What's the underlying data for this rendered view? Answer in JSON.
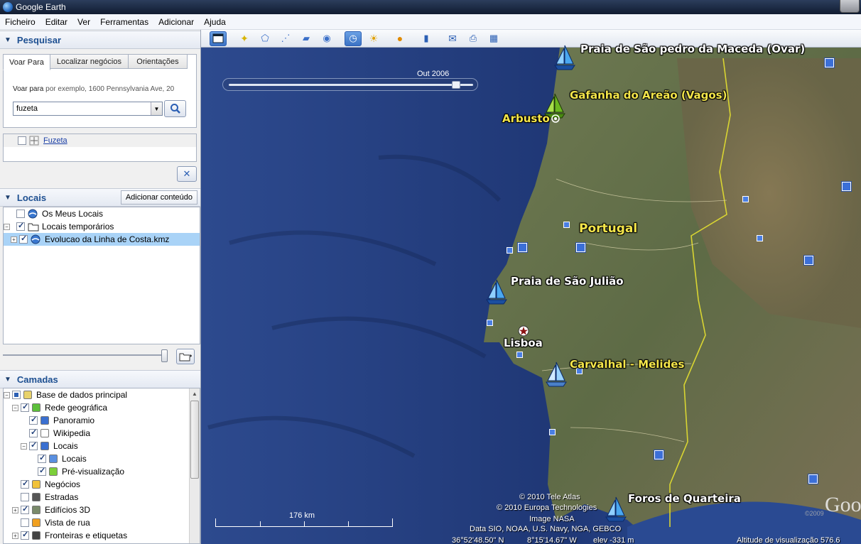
{
  "window": {
    "title": "Google Earth"
  },
  "menu": [
    "Ficheiro",
    "Editar",
    "Ver",
    "Ferramentas",
    "Adicionar",
    "Ajuda"
  ],
  "search": {
    "header": "Pesquisar",
    "tabs": [
      "Voar Para",
      "Localizar negócios",
      "Orientações"
    ],
    "fly_label": "Voar para",
    "fly_hint": "por exemplo, 1600 Pennsylvania Ave, 20",
    "input_value": "fuzeta",
    "result": "Fuzeta"
  },
  "places": {
    "header": "Locais",
    "add_content": "Adicionar conteúdo",
    "items": [
      {
        "label": "Os Meus Locais",
        "checked": false
      },
      {
        "label": "Locais temporários",
        "checked": true
      },
      {
        "label": "Evolucao da Linha de Costa.kmz",
        "checked": true
      }
    ]
  },
  "layers": {
    "header": "Camadas",
    "items": [
      {
        "label": "Base de dados principal",
        "indent": 0,
        "state": "partial"
      },
      {
        "label": "Rede geográfica",
        "indent": 1,
        "state": "checked"
      },
      {
        "label": "Panoramio",
        "indent": 2,
        "state": "checked"
      },
      {
        "label": "Wikipedia",
        "indent": 2,
        "state": "checked"
      },
      {
        "label": "Locais",
        "indent": 2,
        "state": "checked"
      },
      {
        "label": "Locais",
        "indent": 3,
        "state": "checked"
      },
      {
        "label": "Pré-visualização",
        "indent": 3,
        "state": "checked"
      },
      {
        "label": "Negócios",
        "indent": 1,
        "state": "checked"
      },
      {
        "label": "Estradas",
        "indent": 1,
        "state": "unchecked"
      },
      {
        "label": "Edifícios 3D",
        "indent": 1,
        "state": "checked"
      },
      {
        "label": "Vista de rua",
        "indent": 1,
        "state": "unchecked"
      },
      {
        "label": "Fronteiras e etiquetas",
        "indent": 1,
        "state": "checked"
      }
    ]
  },
  "map": {
    "time_label": "Out 2006",
    "labels": {
      "top": "Praia de São pedro da Maceda (Ovar)",
      "gafanha": "Gafanha do Areão (Vagos)",
      "arbusto": "Arbusto",
      "portugal": "Portugal",
      "juliao": "Praia de São Julião",
      "lisboa": "Lisboa",
      "carvalhal": "Carvalhal - Melides",
      "foros": "Foros de Quarteira"
    },
    "scale": "176 km",
    "attribution": [
      "© 2010 Tele Atlas",
      "© 2010 Europa Technologies",
      "Image NASA",
      "Data SIO, NOAA, U.S. Navy, NGA, GEBCO"
    ],
    "status": {
      "lat": "36°52'48.50\" N",
      "lon": "8°15'14.67\" W",
      "elev": "elev -331 m",
      "eye": "Altitude de visualização  576.6"
    },
    "year_badge": "©2009",
    "logo": "Goo"
  },
  "colors": {
    "accent": "#1d4f91",
    "selected": "#a9d3f7",
    "ocean": "#213a77",
    "label_yellow": "#f4e64a"
  }
}
